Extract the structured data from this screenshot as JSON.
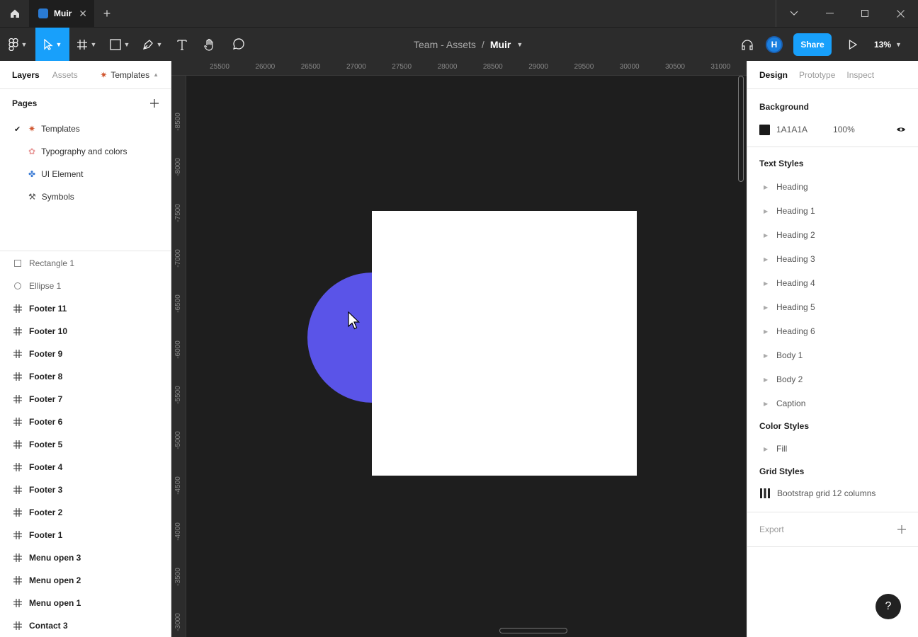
{
  "window": {
    "tab_title": "Muir",
    "new_tab": "+",
    "close": "✕"
  },
  "toolbar": {
    "team": "Team - Assets",
    "separator": "/",
    "file": "Muir",
    "avatar_initial": "H",
    "share_label": "Share",
    "zoom": "13%"
  },
  "left_panel": {
    "tabs": {
      "layers": "Layers",
      "assets": "Assets",
      "page_switch": "Templates"
    },
    "pages_title": "Pages",
    "pages": [
      {
        "label": "Templates",
        "selected": true
      },
      {
        "label": "Typography and colors"
      },
      {
        "label": "UI Element"
      },
      {
        "label": "Symbols"
      }
    ],
    "layers": [
      {
        "label": "Rectangle 1",
        "icon": "rectangle-icon"
      },
      {
        "label": "Ellipse 1",
        "icon": "ellipse-icon"
      },
      {
        "label": "Footer 11",
        "icon": "frame-icon"
      },
      {
        "label": "Footer 10",
        "icon": "frame-icon"
      },
      {
        "label": "Footer 9",
        "icon": "frame-icon"
      },
      {
        "label": "Footer 8",
        "icon": "frame-icon"
      },
      {
        "label": "Footer 7",
        "icon": "frame-icon"
      },
      {
        "label": "Footer 6",
        "icon": "frame-icon"
      },
      {
        "label": "Footer 5",
        "icon": "frame-icon"
      },
      {
        "label": "Footer 4",
        "icon": "frame-icon"
      },
      {
        "label": "Footer 3",
        "icon": "frame-icon"
      },
      {
        "label": "Footer 2",
        "icon": "frame-icon"
      },
      {
        "label": "Footer 1",
        "icon": "frame-icon"
      },
      {
        "label": "Menu open 3",
        "icon": "frame-icon"
      },
      {
        "label": "Menu open 2",
        "icon": "frame-icon"
      },
      {
        "label": "Menu open 1",
        "icon": "frame-icon"
      },
      {
        "label": "Contact 3",
        "icon": "frame-icon"
      }
    ]
  },
  "rulers": {
    "top": [
      "25500",
      "26000",
      "26500",
      "27000",
      "27500",
      "28000",
      "28500",
      "29000",
      "29500",
      "30000",
      "30500",
      "31000"
    ],
    "left": [
      "-8500",
      "-8000",
      "-7500",
      "-7000",
      "-6500",
      "-6000",
      "-5500",
      "-5000",
      "-4500",
      "-4000",
      "-3500",
      "-3000"
    ]
  },
  "canvas": {
    "ellipse_color": "#5A54E8",
    "rectangle_color": "#FFFFFF",
    "background": "#1E1E1E"
  },
  "right_panel": {
    "tabs": {
      "design": "Design",
      "prototype": "Prototype",
      "inspect": "Inspect"
    },
    "background": {
      "title": "Background",
      "hex": "1A1A1A",
      "opacity": "100%"
    },
    "text_styles": {
      "title": "Text Styles",
      "items": [
        "Heading",
        "Heading 1",
        "Heading 2",
        "Heading 3",
        "Heading 4",
        "Heading 5",
        "Heading 6",
        "Body 1",
        "Body 2",
        "Caption"
      ]
    },
    "color_styles": {
      "title": "Color Styles",
      "items": [
        "Fill"
      ]
    },
    "grid_styles": {
      "title": "Grid Styles",
      "items": [
        "Bootstrap grid 12 columns"
      ]
    },
    "export": {
      "title": "Export"
    },
    "help": "?"
  }
}
